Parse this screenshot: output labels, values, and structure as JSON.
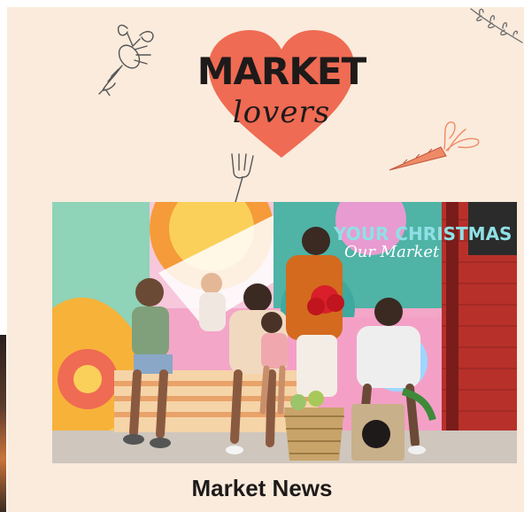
{
  "logo": {
    "title": "MARKET",
    "subtitle": "lovers",
    "heart_color": "#ef6b53",
    "text_color": "#1e1a1a"
  },
  "hero": {
    "headline": "YOUR CHRISTMAS",
    "subline": "Our Market"
  },
  "section": {
    "title": "Market News"
  },
  "colors": {
    "background": "#faebdc",
    "accent": "#ef6b53"
  },
  "icons": [
    "lobster-doodle-icon",
    "fork-doodle-icon",
    "carrot-doodle-icon",
    "herb-sprig-doodle-icon"
  ]
}
